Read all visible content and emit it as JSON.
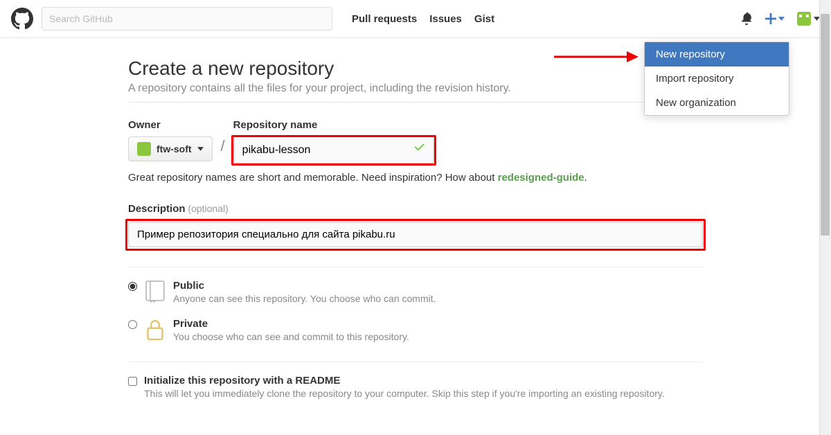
{
  "header": {
    "search_placeholder": "Search GitHub",
    "nav": [
      "Pull requests",
      "Issues",
      "Gist"
    ]
  },
  "dropdown": {
    "items": [
      "New repository",
      "Import repository",
      "New organization"
    ]
  },
  "page": {
    "title": "Create a new repository",
    "subtitle": "A repository contains all the files for your project, including the revision history."
  },
  "form": {
    "owner_label": "Owner",
    "owner_value": "ftw-soft",
    "repo_name_label": "Repository name",
    "repo_name_value": "pikabu-lesson",
    "help_text_prefix": "Great repository names are short and memorable. Need inspiration? How about ",
    "suggestion": "redesigned-guide",
    "period": ".",
    "description_label": "Description",
    "optional_tag": "(optional)",
    "description_value": "Пример репозитория специально для сайта pikabu.ru"
  },
  "visibility": {
    "public_title": "Public",
    "public_desc": "Anyone can see this repository. You choose who can commit.",
    "private_title": "Private",
    "private_desc": "You choose who can see and commit to this repository."
  },
  "readme": {
    "title": "Initialize this repository with a README",
    "desc": "This will let you immediately clone the repository to your computer. Skip this step if you're importing an existing repository."
  }
}
